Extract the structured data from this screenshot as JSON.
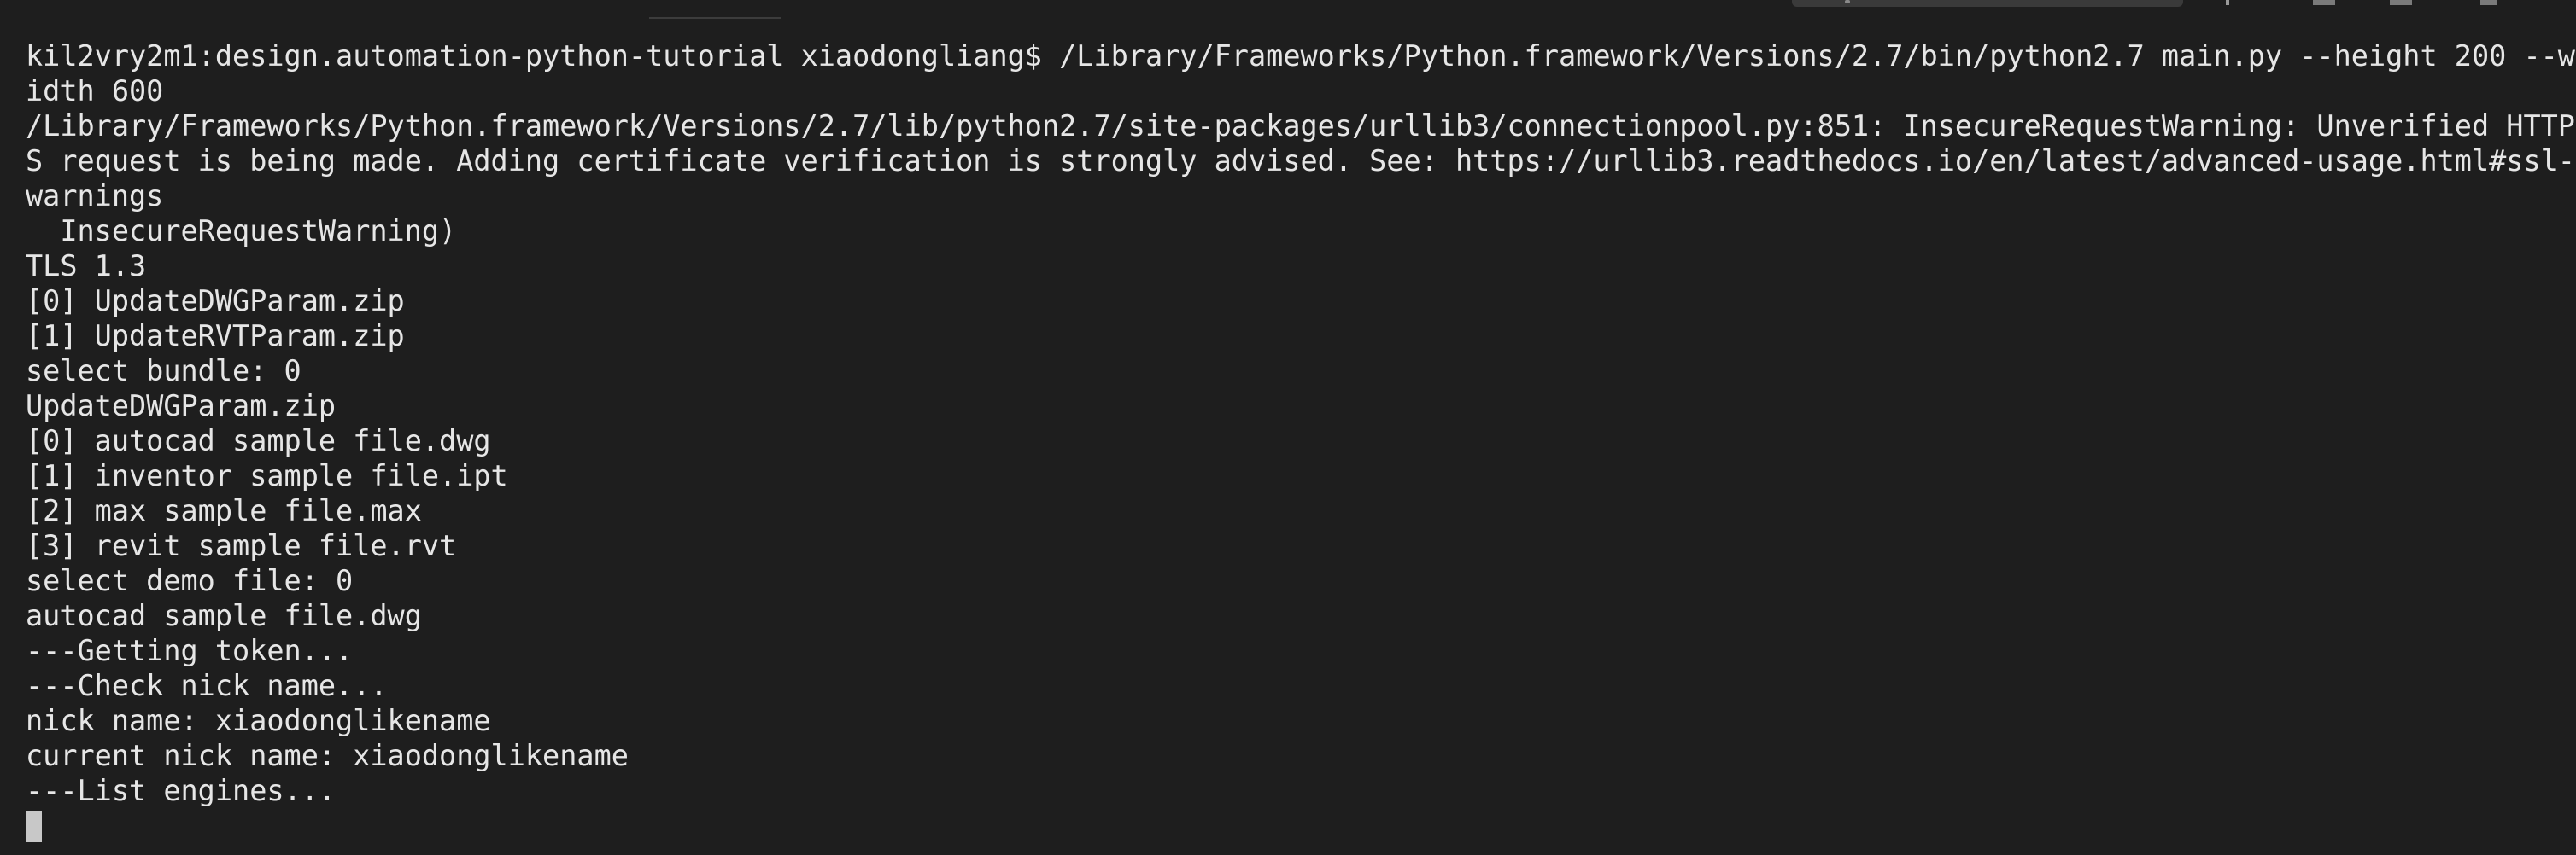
{
  "terminal": {
    "lines": [
      "kil2vry2m1:design.automation-python-tutorial xiaodongliang$ /Library/Frameworks/Python.framework/Versions/2.7/bin/python2.7 main.py --height 200 --w",
      "idth 600",
      "/Library/Frameworks/Python.framework/Versions/2.7/lib/python2.7/site-packages/urllib3/connectionpool.py:851: InsecureRequestWarning: Unverified HTTP",
      "S request is being made. Adding certificate verification is strongly advised. See: https://urllib3.readthedocs.io/en/latest/advanced-usage.html#ssl-",
      "warnings",
      "  InsecureRequestWarning)",
      "TLS 1.3",
      "[0] UpdateDWGParam.zip",
      "[1] UpdateRVTParam.zip",
      "select bundle: 0",
      "UpdateDWGParam.zip",
      "[0] autocad sample file.dwg",
      "[1] inventor sample file.ipt",
      "[2] max sample file.max",
      "[3] revit sample file.rvt",
      "select demo file: 0",
      "autocad sample file.dwg",
      "---Getting token...",
      "---Check nick name...",
      "nick name: xiaodonglikename",
      "current nick name: xiaodonglikename",
      "---List engines..."
    ]
  }
}
